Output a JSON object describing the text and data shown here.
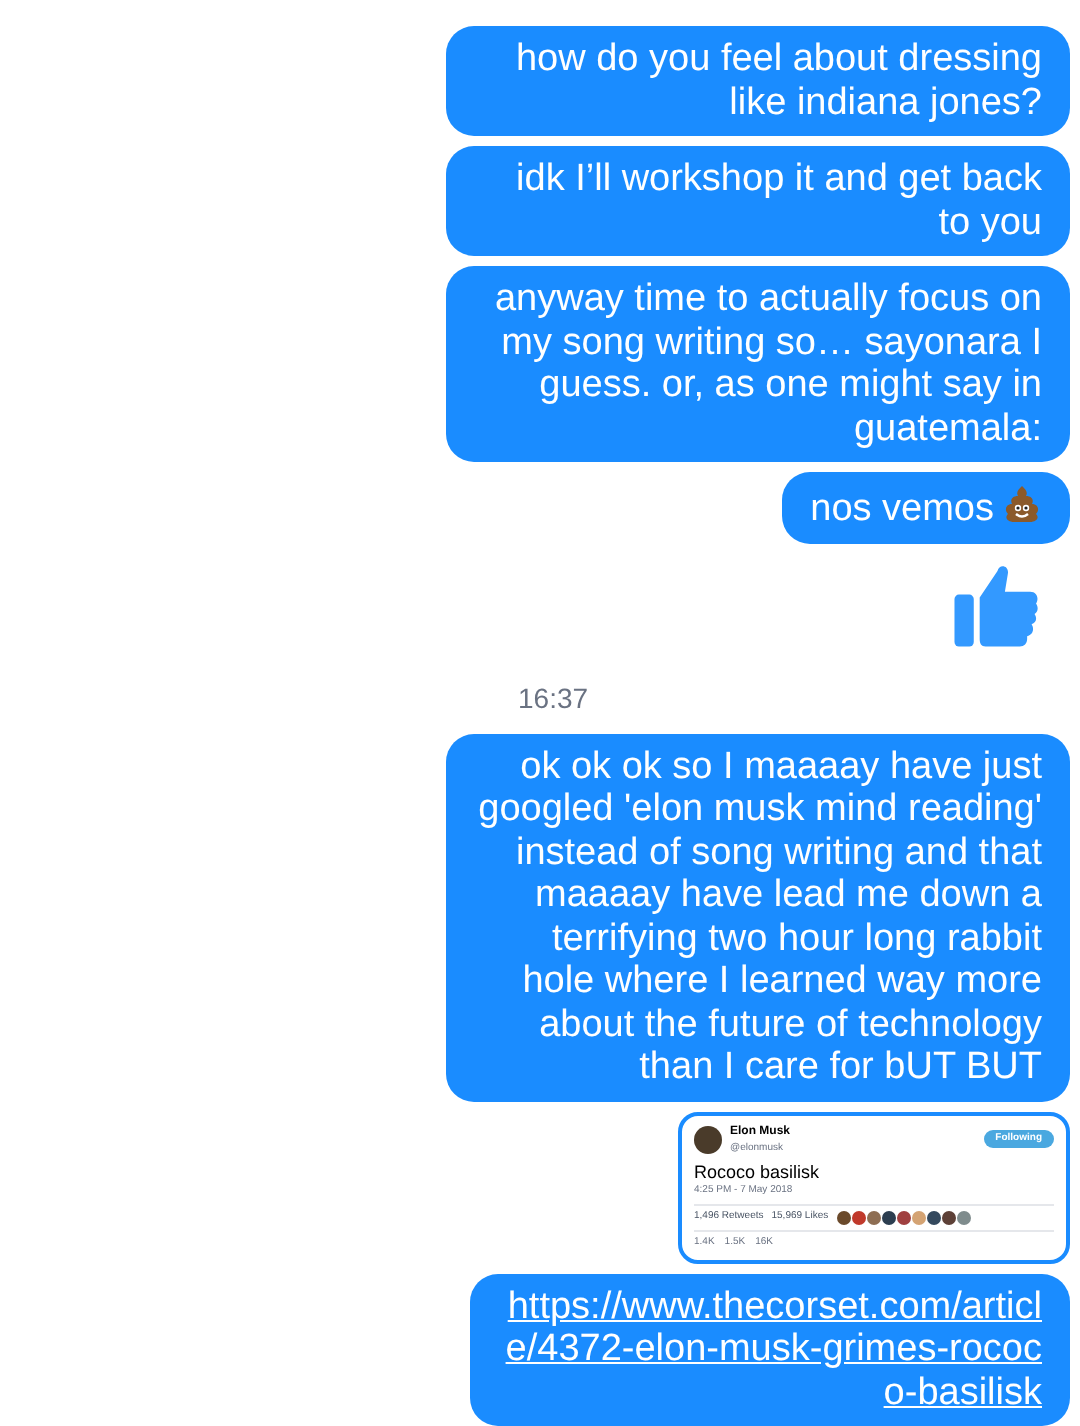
{
  "messages": [
    {
      "kind": "text",
      "text": "how do you feel about dressing like indiana jones?"
    },
    {
      "kind": "text",
      "text": "idk I’ll workshop it and get back to you"
    },
    {
      "kind": "text",
      "text": "anyway time to actually focus on my song writing so… sayonara I guess. or, as one might say in guatemala:"
    },
    {
      "kind": "text_poop",
      "text": "nos vemos"
    },
    {
      "kind": "thumbs"
    },
    {
      "kind": "time",
      "text": "16:37"
    },
    {
      "kind": "text",
      "text": "ok ok ok so I maaaay have just googled 'elon musk mind reading' instead of song writing and that maaaay have lead me down a terrifying two hour long rabbit hole where I learned way more about the future of technology than I care for bUT BUT"
    },
    {
      "kind": "tweet",
      "name": "Elon Musk",
      "handle": "@elonmusk",
      "follow": "Following",
      "body": "Rococo basilisk",
      "date": "4:25 PM - 7 May 2018",
      "retweets": "1,496 Retweets",
      "likes": "15,969 Likes",
      "replies_count": "1.4K",
      "retweet_count": "1.5K",
      "like_count": "16K"
    },
    {
      "kind": "link",
      "text": "https://www.thecorset.com/article/4372-elon-musk-grimes-rococo-basilisk"
    }
  ]
}
